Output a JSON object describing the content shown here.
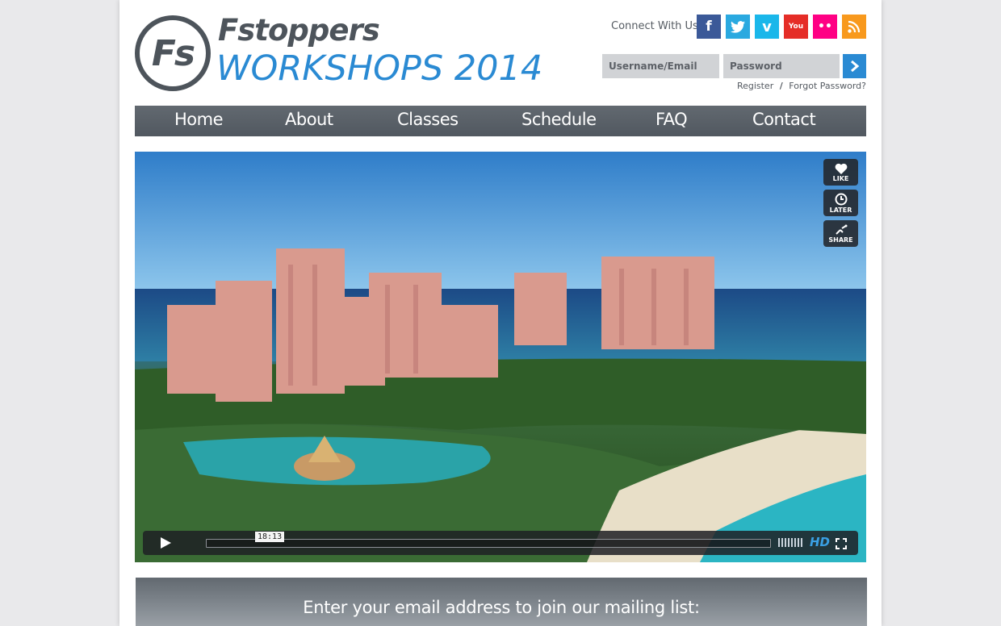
{
  "brand": {
    "mark": "Fs",
    "name": "Fstoppers",
    "subtitle": "WORKSHOPS 2014"
  },
  "social": {
    "label": "Connect With Us:",
    "items": [
      {
        "name": "facebook-icon",
        "glyph": "f",
        "color": "#3b5998"
      },
      {
        "name": "twitter-icon",
        "glyph": "",
        "color": "#2aa9e0"
      },
      {
        "name": "vimeo-icon",
        "glyph": "v",
        "color": "#1ab7ea"
      },
      {
        "name": "youtube-icon",
        "glyph": "You",
        "color": "#e52d27"
      },
      {
        "name": "flickr-icon",
        "glyph": "••",
        "color": "#ff0084"
      },
      {
        "name": "rss-icon",
        "glyph": "",
        "color": "#f8991d"
      }
    ]
  },
  "login": {
    "username_placeholder": "Username/Email",
    "password_placeholder": "Password",
    "register": "Register",
    "separator": "/",
    "forgot": "Forgot Password?"
  },
  "nav": {
    "items": [
      {
        "label": "Home"
      },
      {
        "label": "About"
      },
      {
        "label": "Classes"
      },
      {
        "label": "Schedule"
      },
      {
        "label": "FAQ"
      },
      {
        "label": "Contact"
      }
    ]
  },
  "video": {
    "time": "18:13",
    "quality": "HD",
    "side_buttons": [
      {
        "label": "LIKE",
        "icon": "heart-icon"
      },
      {
        "label": "LATER",
        "icon": "clock-icon"
      },
      {
        "label": "SHARE",
        "icon": "share-icon"
      }
    ],
    "progress": 0.0
  },
  "mailing": {
    "heading": "Enter your email address to join our mailing list:"
  },
  "colors": {
    "accent": "#2a8ad3",
    "nav_bg": "#585f66",
    "logo_gray": "#4d545b"
  }
}
